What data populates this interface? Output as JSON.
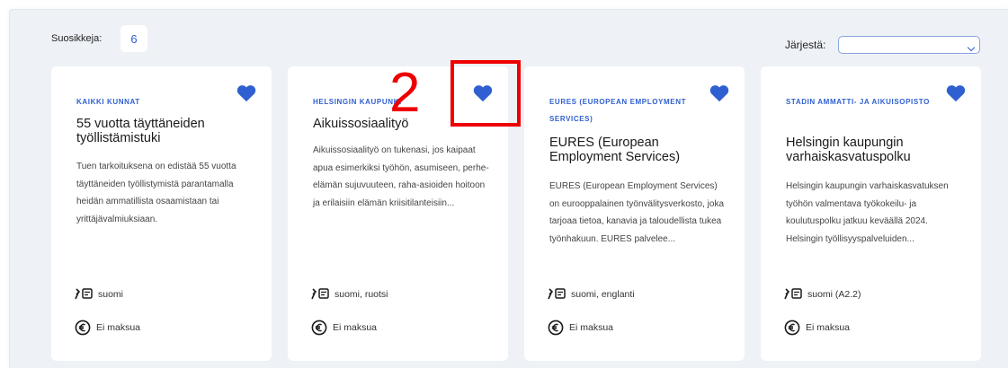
{
  "favorites": {
    "label": "Suosikkeja:",
    "count": "6"
  },
  "sort": {
    "label": "Järjestä:",
    "value": ""
  },
  "annotation": {
    "number": "2"
  },
  "colors": {
    "accent": "#2f5fd0",
    "annotation": "#ee0000",
    "panel_bg": "#eef1f6"
  },
  "cards": [
    {
      "org": "KAIKKI KUNNAT",
      "title": "55 vuotta täyttäneiden työllistämistuki",
      "description": "Tuen tarkoituksena on edistää 55 vuotta täyttäneiden työllistymistä parantamalla heidän ammatillista osaamistaan tai yrittäjävalmiuksiaan.",
      "languages": "suomi",
      "price": "Ei maksua",
      "favorited": true
    },
    {
      "org": "HELSINGIN KAUPUNKI",
      "title": "Aikuissosiaalityö",
      "description": "Aikuissosiaalityö on tukenasi, jos kaipaat apua esimerkiksi työhön, asumiseen, perhe-elämän sujuvuuteen, raha-asioiden hoitoon ja erilaisiin elämän kriisitilanteisiin...",
      "languages": "suomi, ruotsi",
      "price": "Ei maksua",
      "favorited": true
    },
    {
      "org": "EURES (EUROPEAN EMPLOYMENT SERVICES)",
      "title": "EURES (European Employment Services)",
      "description": "EURES (European Employment Services) on eurooppalainen työnvälitysverkosto, joka tarjoaa tietoa, kanavia ja taloudellista tukea työnhakuun. EURES palvelee...",
      "languages": "suomi, englanti",
      "price": "Ei maksua",
      "favorited": true
    },
    {
      "org": "STADIN AMMATTI- JA AIKUISOPISTO",
      "title": "Helsingin kaupungin varhaiskasvatuspolku",
      "description": "Helsingin kaupungin varhaiskasvatuksen työhön valmentava työkokeilu- ja koulutuspolku jatkuu keväällä 2024. Helsingin työllisyyspalveluiden...",
      "languages": "suomi (A2.2)",
      "price": "Ei maksua",
      "favorited": true
    }
  ]
}
